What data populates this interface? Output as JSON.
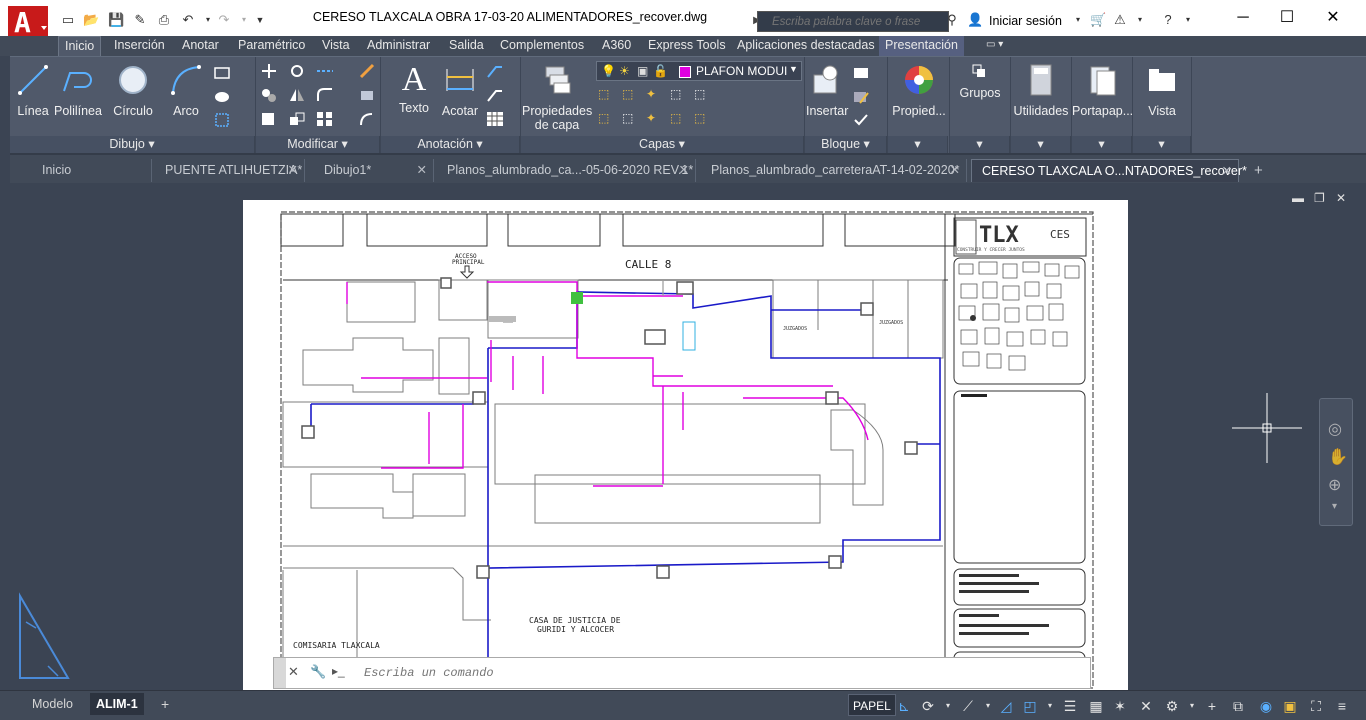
{
  "window": {
    "title": "CERESO TLAXCALA OBRA 17-03-20 ALIMENTADORES_recover.dwg",
    "search_placeholder": "Escriba palabra clave o frase",
    "signin": "Iniciar sesión",
    "minimize": "─",
    "maximize": "☐",
    "close": "✕"
  },
  "ribbon_tabs": [
    "Inicio",
    "Inserción",
    "Anotar",
    "Paramétrico",
    "Vista",
    "Administrar",
    "Salida",
    "Complementos",
    "A360",
    "Express Tools",
    "Aplicaciones destacadas",
    "Presentación"
  ],
  "ribbon": {
    "draw": {
      "linea": "Línea",
      "polilinea": "Polilínea",
      "circulo": "Círculo",
      "arco": "Arco",
      "title": "Dibujo ▾"
    },
    "modify": {
      "title": "Modificar ▾"
    },
    "annotation": {
      "texto": "Texto",
      "acotar": "Acotar",
      "title": "Anotación ▾"
    },
    "layers": {
      "propiedades": "Propiedades",
      "de_capa": "de capa",
      "layer_name": "PLAFON MODUI",
      "title": "Capas ▾",
      "layer_color": "#e000e0"
    },
    "block": {
      "insertar": "Insertar",
      "title": "Bloque ▾"
    },
    "extra": {
      "propiedades": "Propied...",
      "grupos": "Grupos",
      "utilidades": "Utilidades",
      "portapapeles": "Portapap...",
      "vista": "Vista"
    }
  },
  "file_tabs": [
    {
      "label": "Inicio",
      "closable": false
    },
    {
      "label": "PUENTE ATLIHUETZIA*",
      "closable": true
    },
    {
      "label": "Dibujo1*",
      "closable": true
    },
    {
      "label": "Planos_alumbrado_ca...-05-06-2020 REV.1*",
      "closable": true
    },
    {
      "label": "Planos_alumbrado_carreteraAT-14-02-2020*",
      "closable": true
    },
    {
      "label": "CERESO TLAXCALA O...NTADORES_recover*",
      "closable": true,
      "active": true
    }
  ],
  "drawing": {
    "street": "CALLE 8",
    "access": "ACCESO",
    "access2": "PRINCIPAL",
    "juzgados1": "JUZGADOS",
    "juzgados2": "JUZGADOS",
    "casa1": "CASA DE JUSTICIA DE",
    "casa2": "GURIDI Y ALCOCER",
    "comisaria": "COMISARIA TLAXCALA",
    "logo_tlx": "TLX",
    "logo_slogan": "CONSTRUIR Y CRECER JUNTOS",
    "logo_ces": "CES",
    "colors": {
      "magenta": "#e000e0",
      "blue": "#1a1ac8",
      "gray": "#9a9a9a"
    }
  },
  "command": {
    "placeholder": "Escriba un comando"
  },
  "layout_tabs": [
    {
      "label": "Modelo",
      "active": false
    },
    {
      "label": "ALIM-1",
      "active": true
    },
    {
      "label": "+",
      "active": false
    }
  ],
  "status": {
    "papel": "PAPEL"
  }
}
